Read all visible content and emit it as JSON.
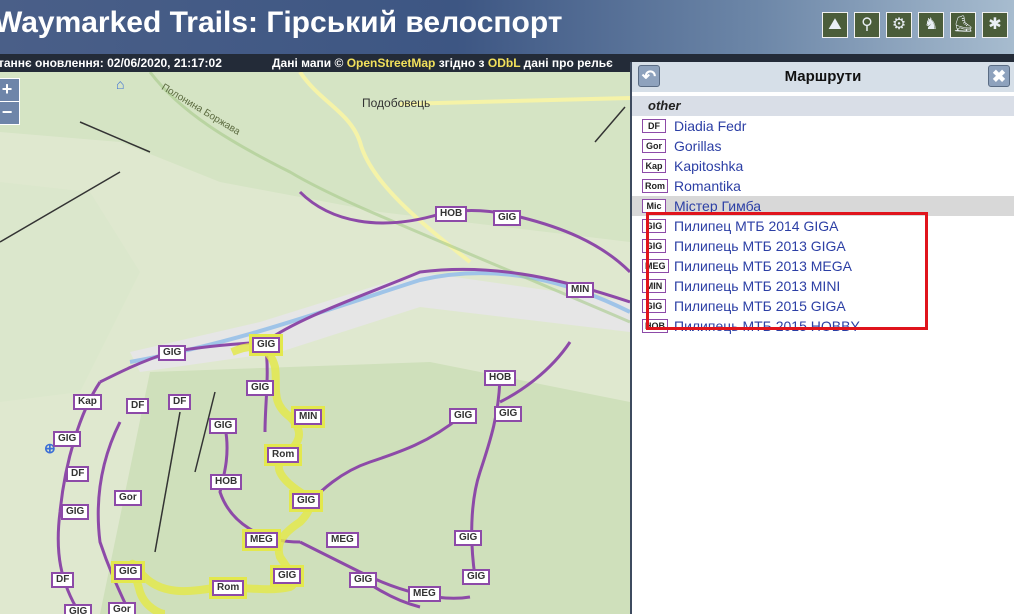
{
  "header": {
    "title": "Waymarked Trails: Гірський велоспорт",
    "tools": [
      "hiking-icon",
      "cycling-icon",
      "mtb-icon",
      "riding-icon",
      "skating-icon",
      "slopes-icon"
    ]
  },
  "status": {
    "last_update": "таннє оновлення: 02/06/2020, 21:17:02",
    "license_prefix": "Дані мапи ©",
    "osm": "OpenStreetMap",
    "license_mid": "згідно з",
    "odbl": "ODbL",
    "license_suffix": "дані про рельє"
  },
  "map": {
    "zoom_in": "+",
    "zoom_out": "−",
    "places": {
      "village": "Подобовець",
      "ridge": "Полонина Боржава"
    },
    "badges": [
      "HOB",
      "GIG",
      "MIN",
      "GIG",
      "GIG",
      "GIG",
      "HOB",
      "Kap",
      "DF",
      "DF",
      "GIG",
      "GIG",
      "MIN",
      "GIG",
      "GIG",
      "DF",
      "Rom",
      "HOB",
      "GIG",
      "GIG",
      "Gor",
      "MEG",
      "MEG",
      "GIG",
      "DF",
      "GIG",
      "GIG",
      "Rom",
      "GIG",
      "GIG",
      "MEG",
      "GIG",
      "Gor"
    ]
  },
  "panel": {
    "title": "Маршрути",
    "back_icon": "↶",
    "close_icon": "✖",
    "group": "other",
    "routes": [
      {
        "badge": "DF",
        "name": "Diadia Fedr"
      },
      {
        "badge": "Gor",
        "name": "Gorillas"
      },
      {
        "badge": "Kap",
        "name": "Kapitoshka"
      },
      {
        "badge": "Rom",
        "name": "Romantika"
      },
      {
        "badge": "Mic",
        "name": "Містер Гимба"
      },
      {
        "badge": "GIG",
        "name": "Пилипец МТБ 2014 GIGA"
      },
      {
        "badge": "GIG",
        "name": "Пилипець МТБ 2013 GIGA"
      },
      {
        "badge": "MEG",
        "name": "Пилипець МТБ 2013 MEGA"
      },
      {
        "badge": "MIN",
        "name": "Пилипець МТБ 2013 MINI"
      },
      {
        "badge": "GIG",
        "name": "Пилипець МТБ 2015 GIGA"
      },
      {
        "badge": "HOB",
        "name": "Пилипець МТБ 2015 HOBBY"
      }
    ]
  },
  "colors": {
    "route_line": "#8d4aa8",
    "highlight": "#e3e84d",
    "annotation": "#e0141c"
  }
}
